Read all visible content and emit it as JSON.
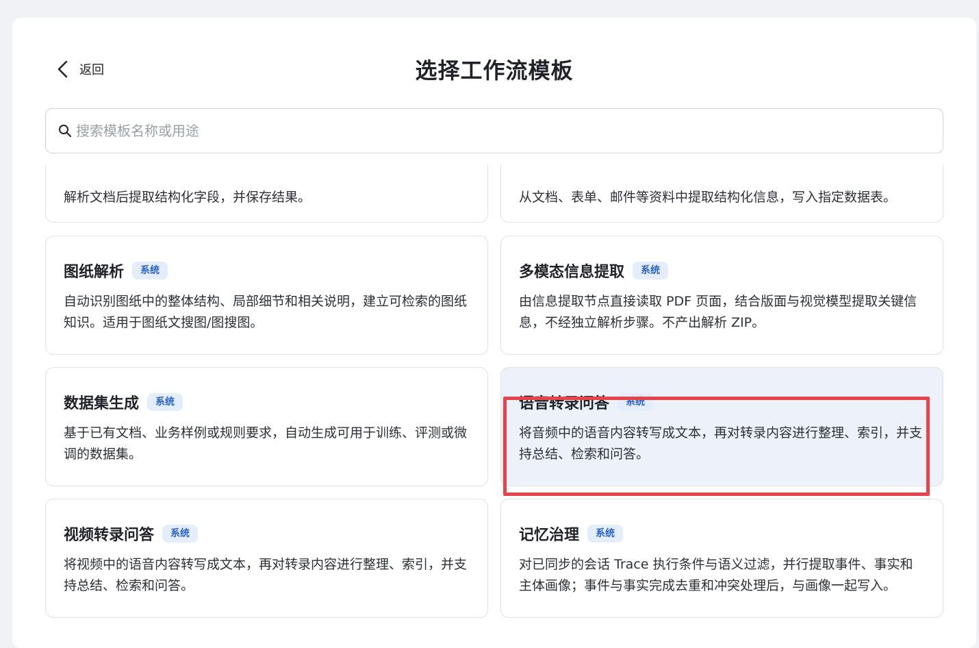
{
  "header": {
    "back_label": "返回",
    "title": "选择工作流模板"
  },
  "search": {
    "placeholder": "搜索模板名称或用途",
    "value": ""
  },
  "colors": {
    "accent": "#2a62c9",
    "tag_bg": "#e3edfc",
    "selected_bg": "#ecf1fa",
    "highlight": "#e8434a"
  },
  "templates": [
    {
      "title": "",
      "tag": "",
      "desc": "解析文档后提取结构化字段，并保存结果。"
    },
    {
      "title": "",
      "tag": "",
      "desc": "从文档、表单、邮件等资料中提取结构化信息，写入指定数据表。"
    },
    {
      "title": "图纸解析",
      "tag": "系统",
      "desc": "自动识别图纸中的整体结构、局部细节和相关说明，建立可检索的图纸知识。适用于图纸文搜图/图搜图。"
    },
    {
      "title": "多模态信息提取",
      "tag": "系统",
      "desc": "由信息提取节点直接读取 PDF 页面，结合版面与视觉模型提取关键信息，不经独立解析步骤。不产出解析 ZIP。"
    },
    {
      "title": "数据集生成",
      "tag": "系统",
      "desc": "基于已有文档、业务样例或规则要求，自动生成可用于训练、评测或微调的数据集。"
    },
    {
      "title": "语音转录问答",
      "tag": "系统",
      "desc": "将音频中的语音内容转写成文本，再对转录内容进行整理、索引，并支持总结、检索和问答。"
    },
    {
      "title": "视频转录问答",
      "tag": "系统",
      "desc": "将视频中的语音内容转写成文本，再对转录内容进行整理、索引，并支持总结、检索和问答。"
    },
    {
      "title": "记忆治理",
      "tag": "系统",
      "desc": "对已同步的会话 Trace 执行条件与语义过滤，并行提取事件、事实和主体画像；事件与事实完成去重和冲突处理后，与画像一起写入。"
    }
  ]
}
